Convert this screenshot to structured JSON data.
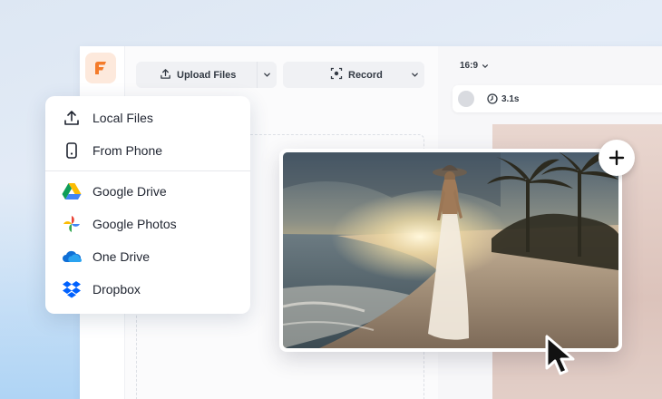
{
  "toolbar": {
    "upload_label": "Upload Files",
    "record_label": "Record"
  },
  "preview": {
    "aspect_ratio": "16:9",
    "duration": "3.1s"
  },
  "upload_menu": {
    "items": [
      {
        "label": "Local Files",
        "icon": "upload-icon"
      },
      {
        "label": "From Phone",
        "icon": "phone-icon"
      },
      {
        "label": "Google Drive",
        "icon": "google-drive-icon"
      },
      {
        "label": "Google Photos",
        "icon": "google-photos-icon"
      },
      {
        "label": "One Drive",
        "icon": "onedrive-icon"
      },
      {
        "label": "Dropbox",
        "icon": "dropbox-icon"
      }
    ]
  },
  "colors": {
    "brand": "#f47b2a",
    "logo_bg": "#fde9dc"
  }
}
